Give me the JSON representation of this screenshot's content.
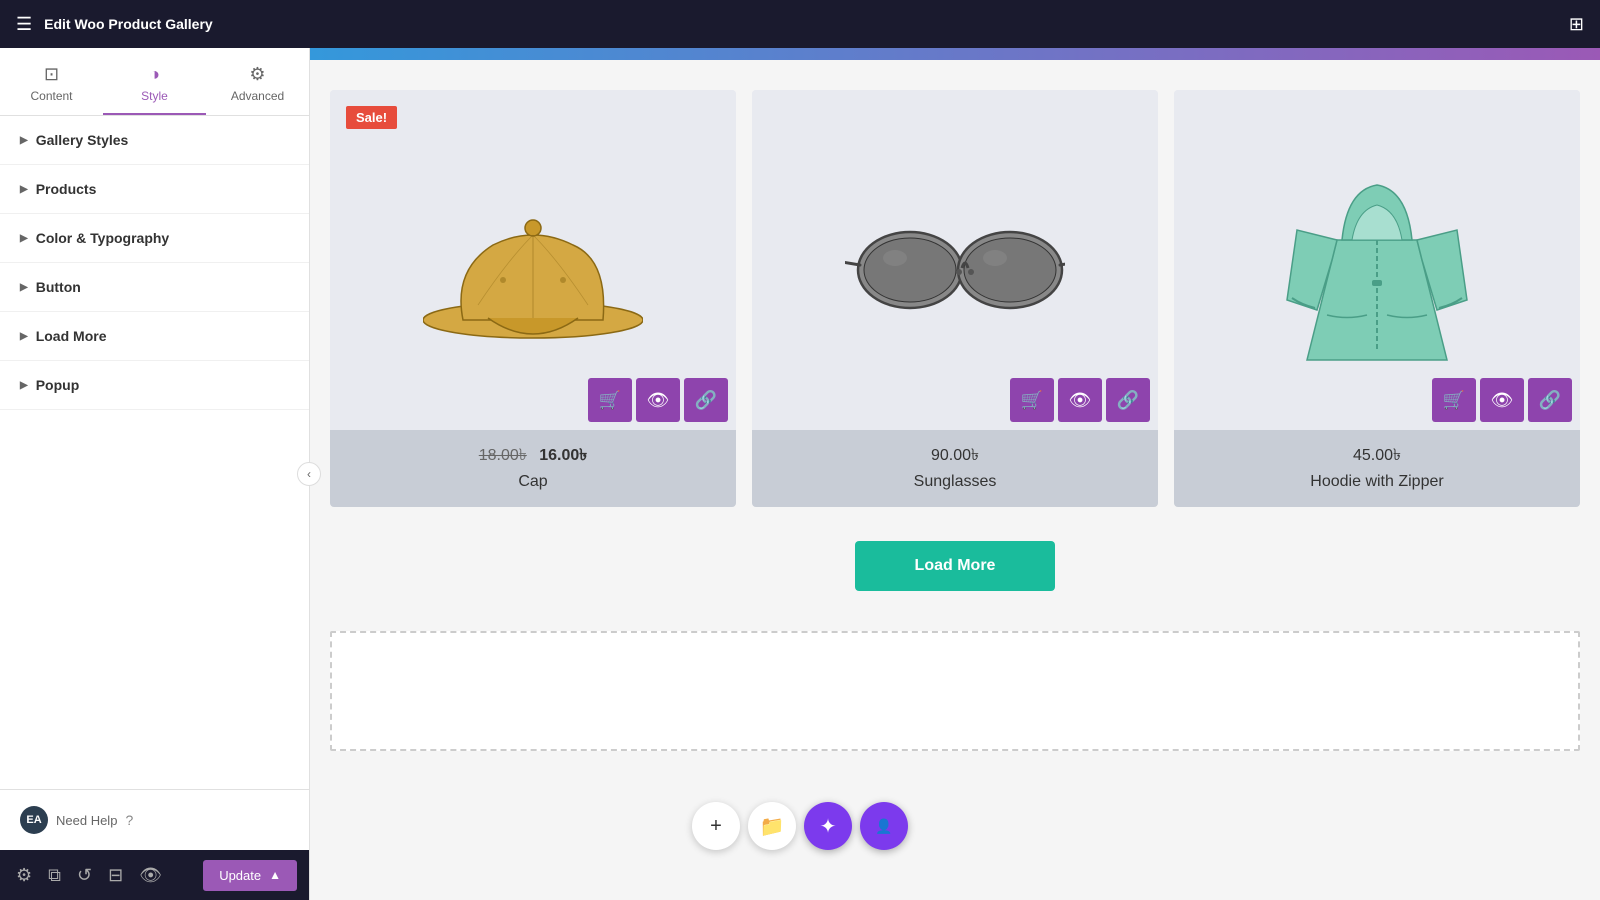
{
  "topbar": {
    "title": "Edit Woo Product Gallery",
    "menu_icon": "☰",
    "grid_icon": "⊞"
  },
  "sidebar": {
    "tabs": [
      {
        "id": "content",
        "label": "Content",
        "icon": "⊡"
      },
      {
        "id": "style",
        "label": "Style",
        "icon": "◑",
        "active": true
      },
      {
        "id": "advanced",
        "label": "Advanced",
        "icon": "⚙"
      }
    ],
    "sections": [
      {
        "id": "gallery-styles",
        "label": "Gallery Styles"
      },
      {
        "id": "products",
        "label": "Products"
      },
      {
        "id": "color-typography",
        "label": "Color & Typography"
      },
      {
        "id": "button",
        "label": "Button"
      },
      {
        "id": "load-more",
        "label": "Load More"
      },
      {
        "id": "popup",
        "label": "Popup"
      }
    ],
    "footer": {
      "need_help": "Need Help"
    },
    "bottom_bar": {
      "update_label": "Update"
    }
  },
  "gallery": {
    "products": [
      {
        "id": "cap",
        "name": "Cap",
        "price_old": "18.00৳",
        "price_new": "16.00৳",
        "has_sale": true,
        "sale_text": "Sale!"
      },
      {
        "id": "sunglasses",
        "name": "Sunglasses",
        "price": "90.00৳",
        "has_sale": false
      },
      {
        "id": "hoodie",
        "name": "Hoodie with Zipper",
        "price": "45.00৳",
        "has_sale": false
      }
    ],
    "load_more_label": "Load More"
  },
  "floating_toolbar": {
    "add": "+",
    "folder": "📁",
    "magic": "✦",
    "avatar": "👤"
  }
}
